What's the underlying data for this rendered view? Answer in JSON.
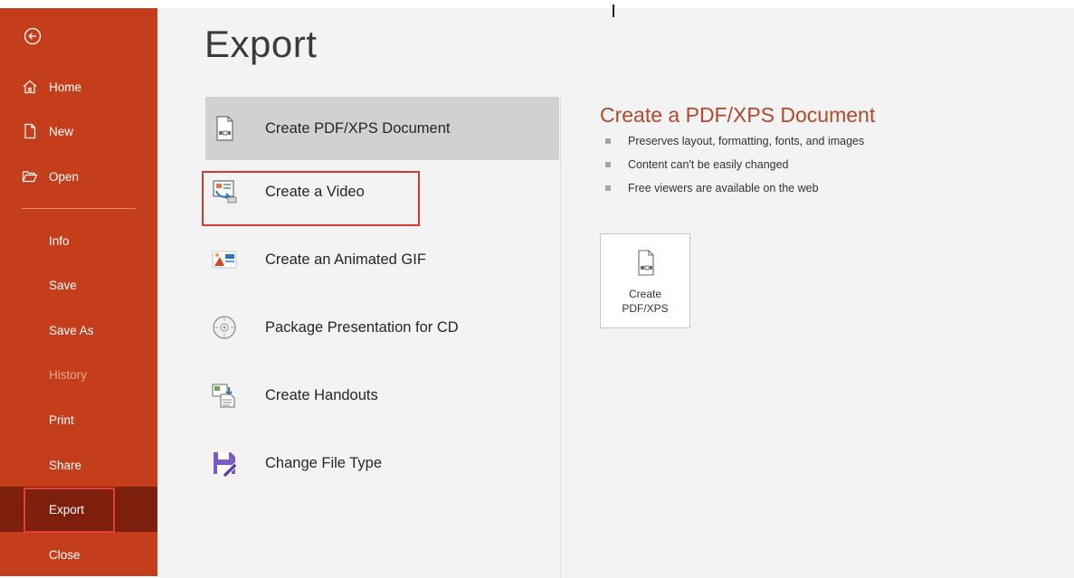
{
  "sidebar": {
    "items": [
      {
        "label": "Home",
        "icon": "home-icon"
      },
      {
        "label": "New",
        "icon": "new-document-icon"
      },
      {
        "label": "Open",
        "icon": "open-folder-icon"
      },
      {
        "label": "Info"
      },
      {
        "label": "Save"
      },
      {
        "label": "Save As"
      },
      {
        "label": "History",
        "disabled": true
      },
      {
        "label": "Print"
      },
      {
        "label": "Share"
      },
      {
        "label": "Export",
        "active": true
      },
      {
        "label": "Close"
      }
    ]
  },
  "main": {
    "title": "Export",
    "options": [
      {
        "label": "Create PDF/XPS Document",
        "selected": true
      },
      {
        "label": "Create a Video"
      },
      {
        "label": "Create an Animated GIF"
      },
      {
        "label": "Package Presentation for CD"
      },
      {
        "label": "Create Handouts"
      },
      {
        "label": "Change File Type"
      }
    ]
  },
  "detail": {
    "title": "Create a PDF/XPS Document",
    "bullets": [
      "Preserves layout, formatting, fonts, and images",
      "Content can't be easily changed",
      "Free viewers are available on the web"
    ],
    "button_label": "Create\nPDF/XPS"
  },
  "colors": {
    "sidebar": "#c43e1c",
    "sidebar_active": "#7e1e0c",
    "accent_title": "#b7472a",
    "highlight_outline": "#cc3a3a"
  }
}
